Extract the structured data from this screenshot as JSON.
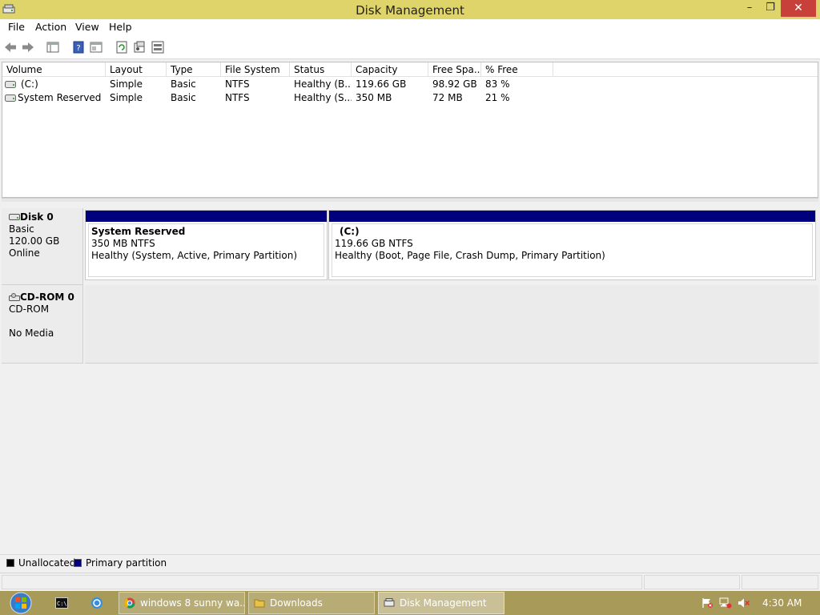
{
  "window": {
    "title": "Disk Management",
    "minimize_glyph": "–",
    "restore_glyph": "❐",
    "close_glyph": "✕"
  },
  "menu": [
    "File",
    "Action",
    "View",
    "Help"
  ],
  "toolbar_icons": [
    "back-icon",
    "forward-icon",
    "show-hide-console-tree-icon",
    "help-icon",
    "properties-icon",
    "refresh-icon",
    "settings-icon",
    "rescan-disks-icon"
  ],
  "volume_list": {
    "columns": [
      "Volume",
      "Layout",
      "Type",
      "File System",
      "Status",
      "Capacity",
      "Free Spa...",
      "% Free"
    ],
    "rows": [
      [
        "(C:)",
        "Simple",
        "Basic",
        "NTFS",
        "Healthy (B...",
        "119.66 GB",
        "98.92 GB",
        "83 %"
      ],
      [
        "System Reserved",
        "Simple",
        "Basic",
        "NTFS",
        "Healthy (S...",
        "350 MB",
        "72 MB",
        "21 %"
      ]
    ]
  },
  "disks": [
    {
      "name": "Disk 0",
      "type": "Basic",
      "size": "120.00 GB",
      "status": "Online",
      "partitions": [
        {
          "name": "System Reserved",
          "size_fs": "350 MB NTFS",
          "status": "Healthy (System, Active, Primary Partition)"
        },
        {
          "name": "(C:)",
          "size_fs": "119.66 GB NTFS",
          "status": "Healthy (Boot, Page File, Crash Dump, Primary Partition)"
        }
      ]
    },
    {
      "name": "CD-ROM 0",
      "type": "CD-ROM",
      "media": "No Media"
    }
  ],
  "legend": [
    {
      "label": "Unallocated",
      "color": "#000000"
    },
    {
      "label": "Primary partition",
      "color": "#00007f"
    }
  ],
  "taskbar": {
    "tasks": [
      {
        "label": "windows 8 sunny wa...",
        "icon": "chrome-icon"
      },
      {
        "label": "Downloads",
        "icon": "folder-icon"
      },
      {
        "label": "Disk Management",
        "icon": "disk-management-icon",
        "active": true
      }
    ],
    "clock": "4:30 AM"
  },
  "colors": {
    "titlebar": "#dfd46a",
    "partition_bar": "#00007f",
    "close_button": "#c7413a",
    "taskbar": "#a89a58"
  }
}
